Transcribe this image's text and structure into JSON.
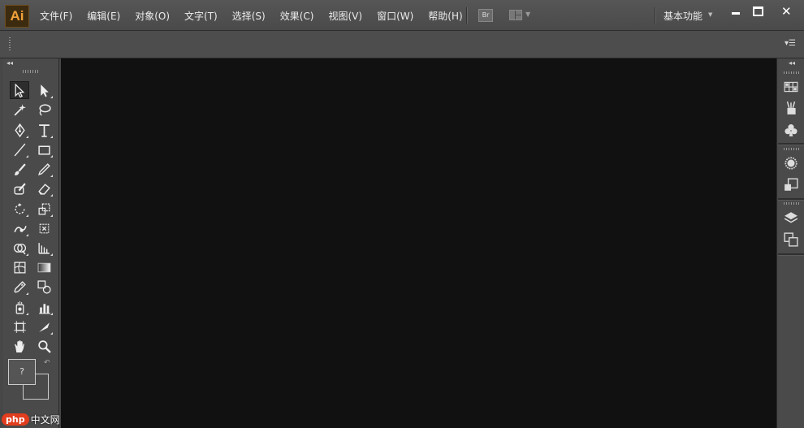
{
  "app": {
    "logo_text": "Ai",
    "brand_color": "#f0a23a"
  },
  "menu": {
    "items": [
      {
        "label": "文件(F)"
      },
      {
        "label": "编辑(E)"
      },
      {
        "label": "对象(O)"
      },
      {
        "label": "文字(T)"
      },
      {
        "label": "选择(S)"
      },
      {
        "label": "效果(C)"
      },
      {
        "label": "视图(V)"
      },
      {
        "label": "窗口(W)"
      },
      {
        "label": "帮助(H)"
      }
    ],
    "bridge_label": "Br",
    "workspace_label": "基本功能"
  },
  "toolbox": {
    "fill_label": "?",
    "tools": [
      "selection-tool",
      "direct-selection-tool",
      "magic-wand-tool",
      "lasso-tool",
      "pen-tool",
      "type-tool",
      "line-segment-tool",
      "rectangle-tool",
      "paintbrush-tool",
      "pencil-tool",
      "blob-brush-tool",
      "eraser-tool",
      "rotate-tool",
      "scale-tool",
      "warp-tool",
      "free-transform-tool",
      "shape-builder-tool",
      "perspective-grid-tool",
      "mesh-tool",
      "gradient-tool",
      "eyedropper-tool",
      "blend-tool",
      "symbol-sprayer-tool",
      "column-graph-tool",
      "artboard-tool",
      "slice-tool",
      "hand-tool",
      "zoom-tool"
    ]
  },
  "canvas": {
    "background": "#111111"
  },
  "watermark": {
    "badge": "php",
    "text": "中文网"
  }
}
